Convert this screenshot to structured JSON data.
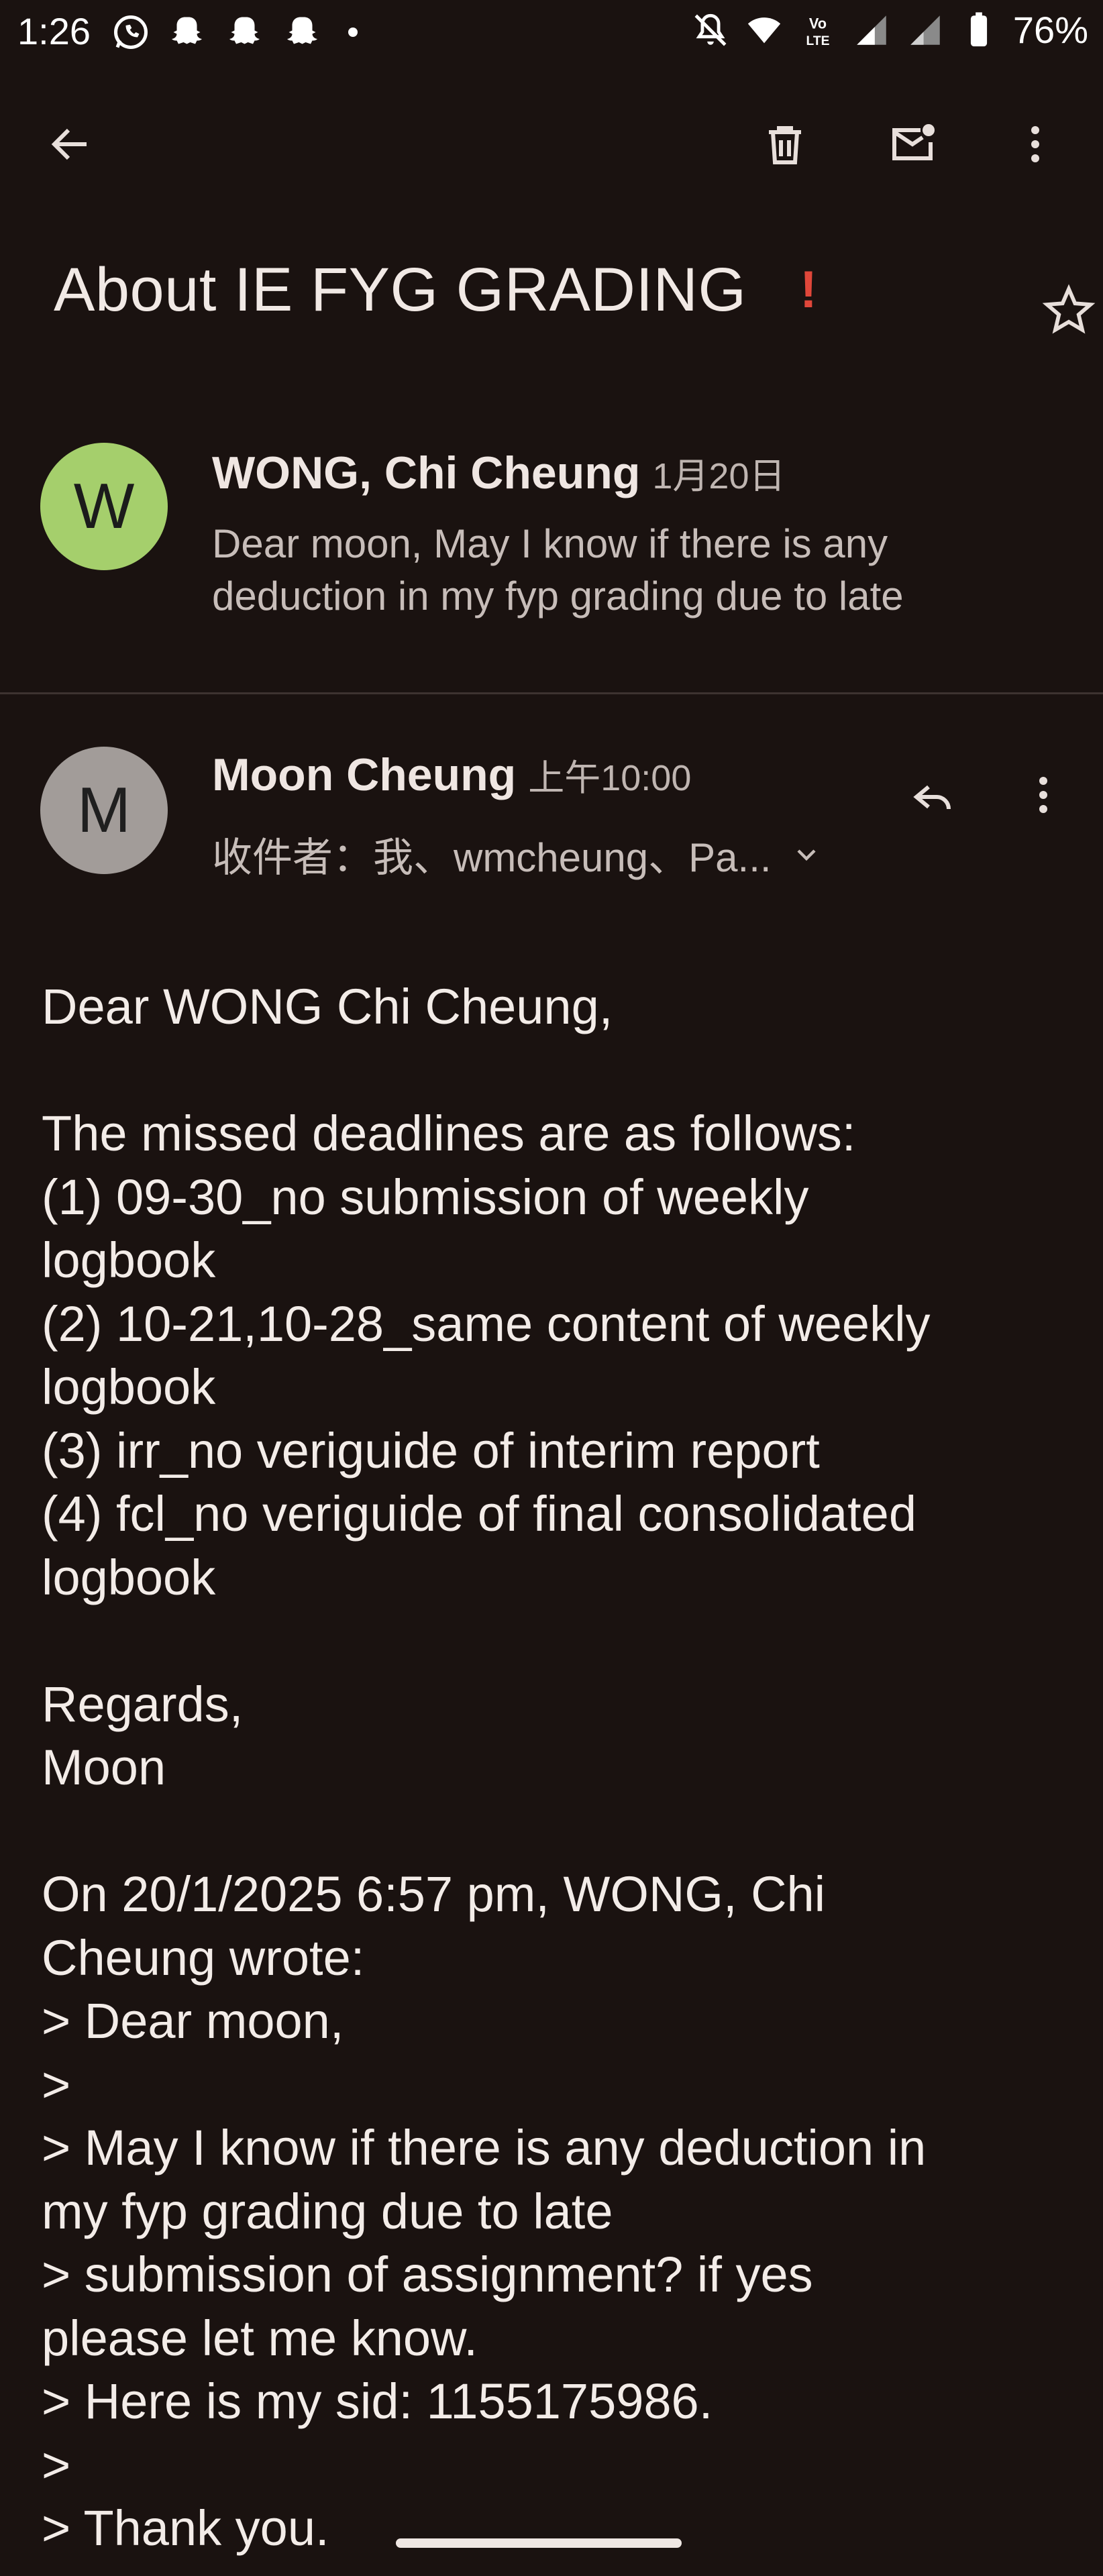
{
  "status_bar": {
    "time": "1:26",
    "battery": "76%",
    "network_label": "LTE"
  },
  "email": {
    "subject": "About IE FYG GRADING",
    "importance_mark": "!",
    "messages": [
      {
        "avatar_letter": "W",
        "avatar_color": "#a5cf6c",
        "sender": "WONG, Chi Cheung",
        "date": "1月20日",
        "snippet": "Dear moon, May I know if there is any deduction in my fyp grading due to late"
      },
      {
        "avatar_letter": "M",
        "avatar_color": "#a29c99",
        "sender": "Moon Cheung",
        "date": "上午10:00",
        "recipients": "收件者：我、wmcheung、Pa..."
      }
    ],
    "body_lines": [
      "Dear WONG Chi Cheung,",
      "",
      "The missed deadlines are as follows:",
      "(1) 09-30_no submission of weekly",
      "logbook",
      "(2) 10-21,10-28_same content of weekly",
      "logbook",
      "(3) irr_no veriguide of interim report",
      "(4) fcl_no veriguide of final consolidated",
      "logbook",
      "",
      "Regards,",
      "Moon",
      "",
      "On 20/1/2025 6:57 pm, WONG, Chi",
      "Cheung wrote:",
      "> Dear moon,",
      ">",
      "> May I know if there is any deduction in",
      "my fyp grading due to late",
      "> submission of assignment? if yes",
      "please let me know.",
      "> Here is my sid: 1155175986.",
      ">",
      "> Thank you."
    ]
  },
  "colors": {
    "background": "#1a1210",
    "importance": "#e0473a"
  }
}
